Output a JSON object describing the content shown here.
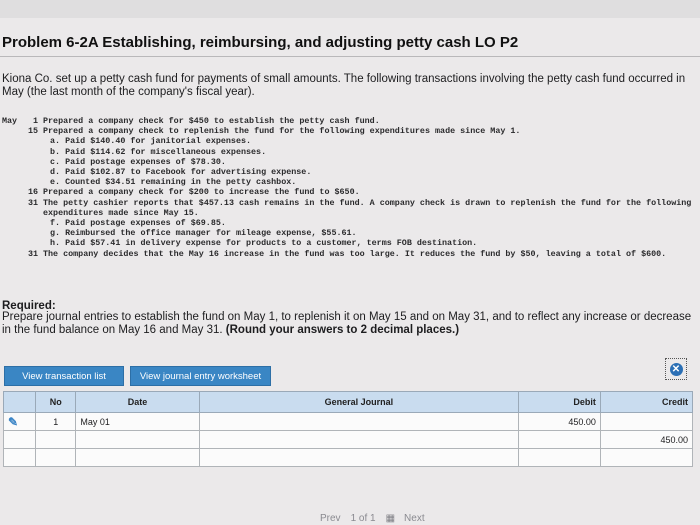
{
  "problem": {
    "title": "Problem 6-2A Establishing, reimbursing, and adjusting petty cash LO P2",
    "intro": "Kiona Co. set up a petty cash fund for payments of small amounts. The following transactions involving the petty cash fund occurred in May (the last month of the company's fiscal year)."
  },
  "transactions": [
    {
      "month": "May",
      "day": "1",
      "text": "Prepared a company check for $450 to establish the petty cash fund.",
      "sub": false
    },
    {
      "month": "",
      "day": "15",
      "text": "Prepared a company check to replenish the fund for the following expenditures made since May 1.",
      "sub": false
    },
    {
      "month": "",
      "day": "",
      "text": "a. Paid $140.40 for janitorial expenses.",
      "sub": true
    },
    {
      "month": "",
      "day": "",
      "text": "b. Paid $114.62 for miscellaneous expenses.",
      "sub": true
    },
    {
      "month": "",
      "day": "",
      "text": "c. Paid postage expenses of $78.30.",
      "sub": true
    },
    {
      "month": "",
      "day": "",
      "text": "d. Paid $102.87 to Facebook for advertising expense.",
      "sub": true
    },
    {
      "month": "",
      "day": "",
      "text": "e. Counted $34.51 remaining in the petty cashbox.",
      "sub": true
    },
    {
      "month": "",
      "day": "16",
      "text": "Prepared a company check for $200 to increase the fund to $650.",
      "sub": false
    },
    {
      "month": "",
      "day": "31",
      "text": "The petty cashier reports that $457.13 cash remains in the fund. A company check is drawn to replenish the fund for the following expenditures made since May 15.",
      "sub": false
    },
    {
      "month": "",
      "day": "",
      "text": "f. Paid postage expenses of $69.85.",
      "sub": true
    },
    {
      "month": "",
      "day": "",
      "text": "g. Reimbursed the office manager for mileage expense, $55.61.",
      "sub": true
    },
    {
      "month": "",
      "day": "",
      "text": "h. Paid $57.41 in delivery expense for products to a customer, terms FOB destination.",
      "sub": true
    },
    {
      "month": "",
      "day": "31",
      "text": "The company decides that the May 16 increase in the fund was too large. It reduces the fund by $50, leaving a total of $600.",
      "sub": false
    }
  ],
  "required": {
    "label": "Required:",
    "text": "Prepare journal entries to establish the fund on May 1, to replenish it on May 15 and on May 31, and to reflect any increase or decrease in the fund balance on May 16 and May 31.",
    "bold_note": "(Round your answers to 2 decimal places.)"
  },
  "buttons": {
    "view_transactions": "View transaction list",
    "view_worksheet": "View journal entry worksheet"
  },
  "journal": {
    "headers": {
      "no": "No",
      "date": "Date",
      "account": "General Journal",
      "debit": "Debit",
      "credit": "Credit"
    },
    "rows": [
      {
        "no": "1",
        "date": "May 01",
        "account": "",
        "debit": "450.00",
        "credit": ""
      },
      {
        "no": "",
        "date": "",
        "account": "",
        "debit": "",
        "credit": "450.00"
      },
      {
        "no": "",
        "date": "",
        "account": "",
        "debit": "",
        "credit": ""
      }
    ]
  },
  "pager": {
    "prev": "Prev",
    "page": "1 of 1",
    "next": "Next"
  },
  "colors": {
    "accent": "#3a86c4",
    "header_bg": "#c9dcef"
  }
}
